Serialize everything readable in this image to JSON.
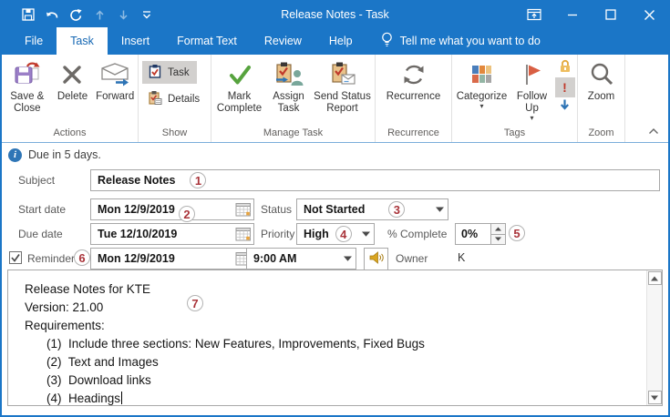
{
  "titlebar": {
    "title": "Release Notes - Task",
    "qat_icons": [
      "save-icon",
      "undo-icon",
      "redo-icon",
      "move-up-icon",
      "move-down-icon",
      "customize-quick-access-icon"
    ],
    "window_controls": [
      "ribbon-display-options-icon",
      "minimize-icon",
      "maximize-icon",
      "close-icon"
    ]
  },
  "tabbar": {
    "tabs": [
      {
        "label": "File",
        "selected": false
      },
      {
        "label": "Task",
        "selected": true
      },
      {
        "label": "Insert",
        "selected": false
      },
      {
        "label": "Format Text",
        "selected": false
      },
      {
        "label": "Review",
        "selected": false
      },
      {
        "label": "Help",
        "selected": false
      }
    ],
    "tell_me": "Tell me what you want to do"
  },
  "ribbon": {
    "groups": [
      {
        "label": "Actions",
        "buttons": [
          {
            "label": "Save & Close",
            "icon": "save-close-icon"
          },
          {
            "label": "Delete",
            "icon": "delete-icon"
          },
          {
            "label": "Forward",
            "icon": "forward-icon"
          }
        ]
      },
      {
        "label": "Show",
        "buttons": [
          {
            "label": "Task",
            "icon": "task-clipboard-icon",
            "selected": true
          },
          {
            "label": "Details",
            "icon": "details-clipboard-icon",
            "selected": false
          }
        ]
      },
      {
        "label": "Manage Task",
        "buttons": [
          {
            "label": "Mark Complete",
            "icon": "mark-complete-check-icon"
          },
          {
            "label": "Assign Task",
            "icon": "assign-task-icon"
          },
          {
            "label": "Send Status Report",
            "icon": "send-status-report-icon"
          }
        ]
      },
      {
        "label": "Recurrence",
        "buttons": [
          {
            "label": "Recurrence",
            "icon": "recurrence-icon"
          }
        ]
      },
      {
        "label": "Tags",
        "buttons": [
          {
            "label": "Categorize",
            "icon": "categorize-icon"
          },
          {
            "label": "Follow Up",
            "icon": "follow-up-flag-icon"
          },
          {
            "label": "",
            "icon": "private-lock-icon"
          },
          {
            "label": "!",
            "icon": "high-importance-icon",
            "selected": true
          },
          {
            "label": "",
            "icon": "low-importance-icon"
          }
        ]
      },
      {
        "label": "Zoom",
        "buttons": [
          {
            "label": "Zoom",
            "icon": "zoom-magnifier-icon"
          }
        ]
      }
    ]
  },
  "infobar": {
    "text": "Due in 5 days."
  },
  "form": {
    "subject": {
      "label": "Subject",
      "value": "Release Notes"
    },
    "start_date": {
      "label": "Start date",
      "value": "Mon 12/9/2019"
    },
    "due_date": {
      "label": "Due date",
      "value": "Tue 12/10/2019"
    },
    "status": {
      "label": "Status",
      "value": "Not Started"
    },
    "priority": {
      "label": "Priority",
      "value": "High"
    },
    "percent_complete": {
      "label": "% Complete",
      "value": "0%"
    },
    "reminder": {
      "label": "Reminder",
      "checked": true,
      "date": "Mon 12/9/2019",
      "time": "9:00 AM"
    },
    "owner": {
      "label": "Owner",
      "value": "K"
    }
  },
  "annotations": [
    "1",
    "2",
    "3",
    "4",
    "5",
    "6",
    "7"
  ],
  "body": {
    "lines": [
      "Release Notes for KTE",
      "Version: 21.00",
      "Requirements:"
    ],
    "items": [
      "(1)  Include three sections: New Features, Improvements, Fixed Bugs",
      "(2)  Text and Images",
      "(3)  Download links",
      "(4)  Headings"
    ]
  },
  "colors": {
    "titlebar_blue": "#1b76c7",
    "selected_tab_text": "#1567b3",
    "annotation_red": "#a9343a",
    "flag_red": "#d95f43",
    "importance_red": "#c0392b",
    "check_green": "#57a33e",
    "lock_gold": "#eebd5e",
    "arrow_blue": "#2e74b5",
    "ribbon_border_blue": "#7badda"
  }
}
